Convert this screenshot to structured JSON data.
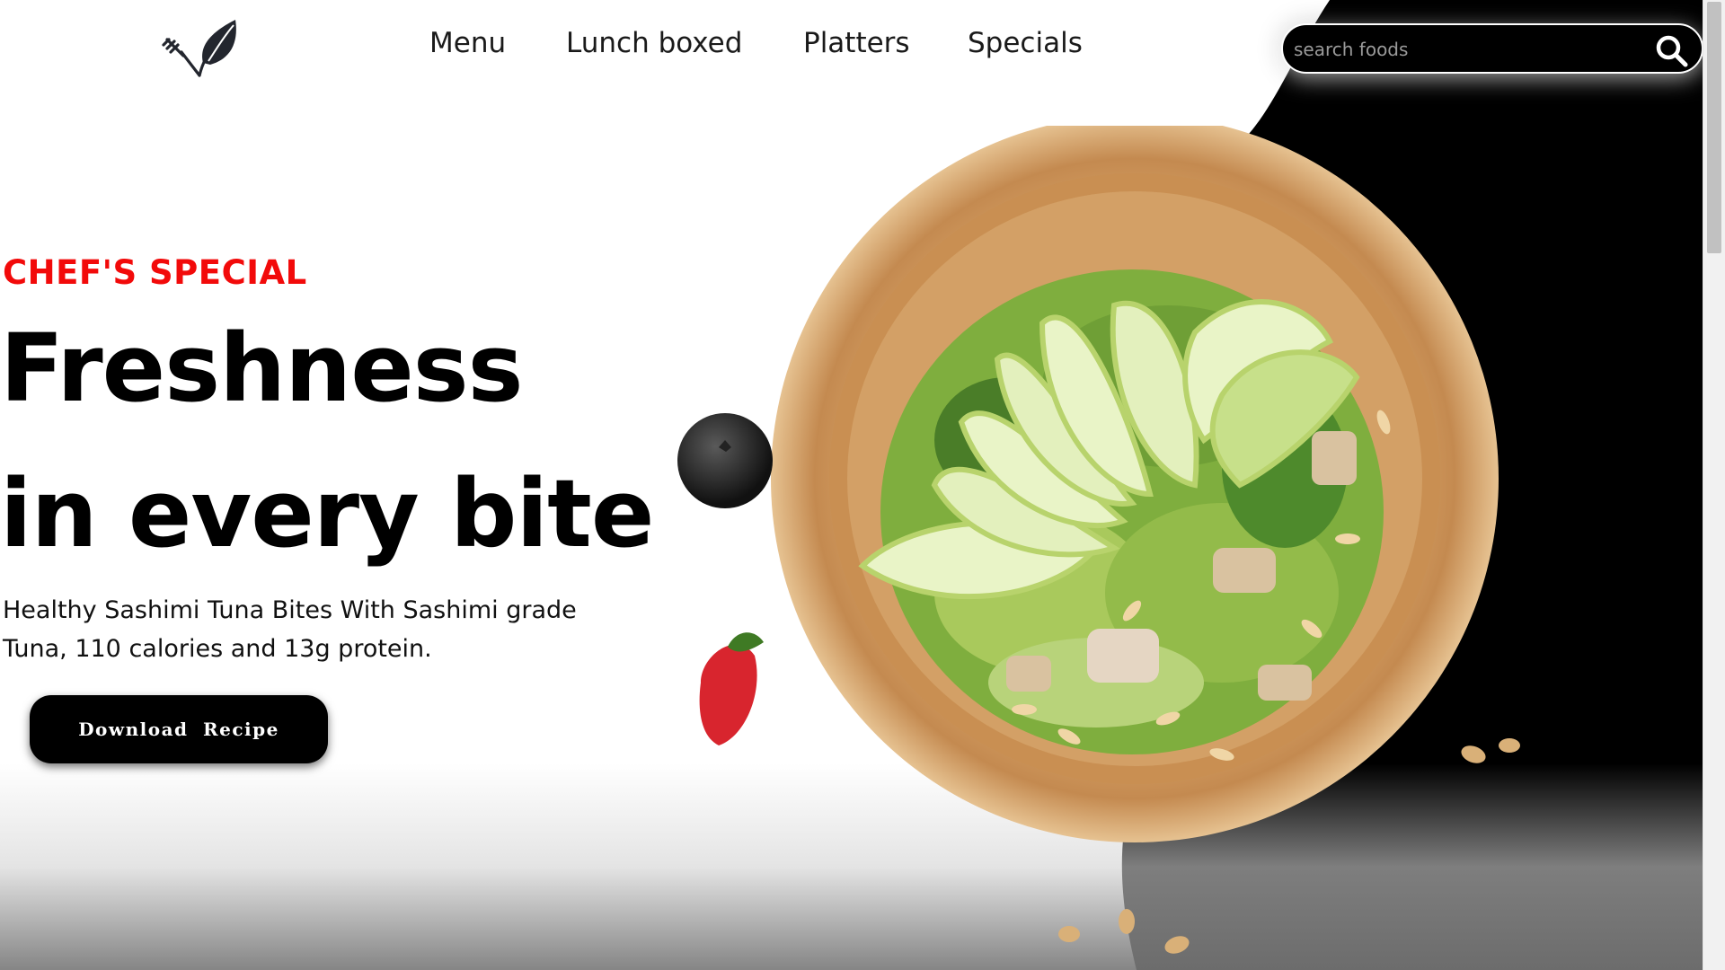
{
  "nav": {
    "items": [
      {
        "label": "Menu"
      },
      {
        "label": "Lunch boxed"
      },
      {
        "label": "Platters"
      },
      {
        "label": "Specials"
      }
    ]
  },
  "search": {
    "placeholder": "search foods",
    "icon": "search-icon"
  },
  "hero": {
    "kicker": "CHEF'S SPECIAL",
    "headline_line1": "Freshness",
    "headline_line2": "in every bite",
    "description": "Healthy Sashimi Tuna Bites With Sashimi grade Tuna, 110 calories and 13g protein.",
    "cta_label": "Download  Recipe"
  },
  "logo": {
    "icon": "fork-leaf-logo-icon"
  },
  "colors": {
    "accent_red": "#f20a0a",
    "background": "#ffffff",
    "dark": "#000000"
  }
}
